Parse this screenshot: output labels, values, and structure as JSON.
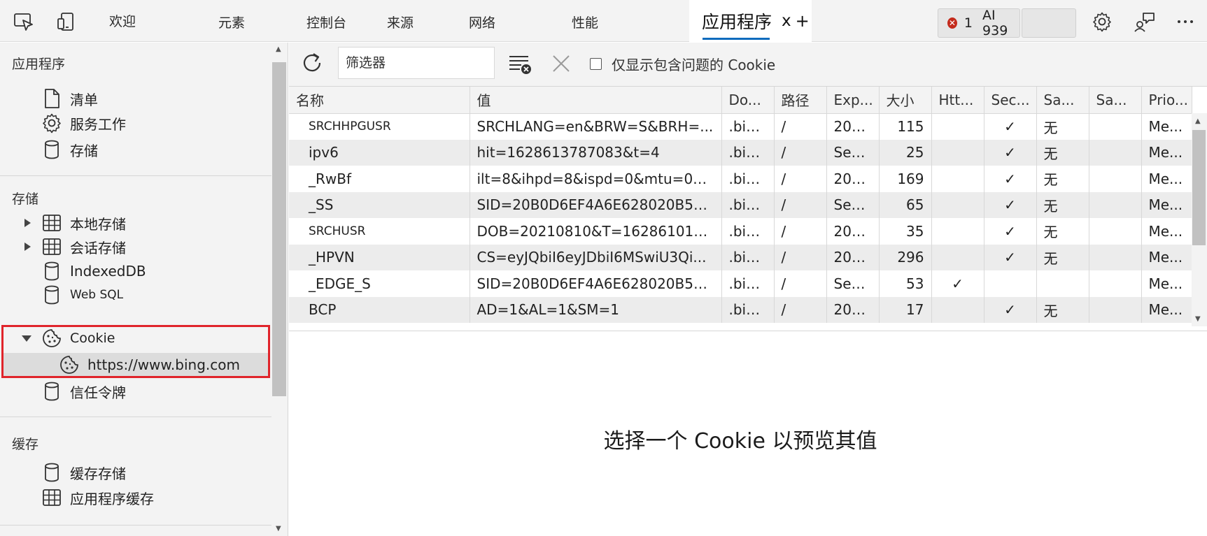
{
  "topbar": {
    "tabs": [
      "欢迎",
      "元素",
      "控制台",
      "来源",
      "网络",
      "性能"
    ],
    "active_tab": "应用程序",
    "close_label": "x",
    "new_tab_label": "+",
    "error_count": "1",
    "ai_label": "AI 939"
  },
  "sidebar": {
    "app_heading": "应用程序",
    "app_items": [
      "清单",
      "服务工作",
      "存储"
    ],
    "storage_heading": "存储",
    "storage_items": [
      "本地存储",
      "会话存储",
      "IndexedDB",
      "Web SQL",
      "Cookie",
      "https://www.bing.com",
      "信任令牌"
    ],
    "cache_heading": "缓存",
    "cache_items": [
      "缓存存储",
      "应用程序缓存"
    ]
  },
  "toolbar": {
    "filter_placeholder": "筛选器",
    "only_issues_label": "仅显示包含问题的 Cookie"
  },
  "table": {
    "columns": [
      "名称",
      "值",
      "Do...",
      "路径",
      "Exp...",
      "大小",
      "Htt...",
      "Sec...",
      "Sa...",
      "Sa...",
      "Prio..."
    ],
    "rows": [
      [
        "SRCHHPGUSR",
        "SRCHLANG=en&BRW=S&BRH=...",
        ".bin...",
        "/",
        "202...",
        "115",
        "",
        "✓",
        "无",
        "",
        "Me..."
      ],
      [
        "ipv6",
        "hit=1628613787083&t=4",
        ".bin...",
        "/",
        "Ses...",
        "25",
        "",
        "✓",
        "无",
        "",
        "Me..."
      ],
      [
        "_RwBf",
        "ilt=8&ihpd=8&ispd=0&mtu=0&...",
        ".bin...",
        "/",
        "202...",
        "169",
        "",
        "✓",
        "无",
        "",
        "Me..."
      ],
      [
        "_SS",
        "SID=20B0D6EF4A6E628020B5C6...",
        ".bin...",
        "/",
        "Ses...",
        "65",
        "",
        "✓",
        "无",
        "",
        "Me..."
      ],
      [
        "SRCHUSR",
        "DOB=20210810&T=1628610183...",
        ".bin...",
        "/",
        "202...",
        "35",
        "",
        "✓",
        "无",
        "",
        "Me..."
      ],
      [
        "_HPVN",
        "CS=eyJQbiI6eyJDbiI6MSwiU3Qi...",
        ".bin...",
        "/",
        "202...",
        "296",
        "",
        "✓",
        "无",
        "",
        "Me..."
      ],
      [
        "_EDGE_S",
        "SID=20B0D6EF4A6E628020B5C6...",
        ".bin...",
        "/",
        "Ses...",
        "53",
        "✓",
        "",
        "",
        "",
        "Me..."
      ],
      [
        "BCP",
        "AD=1&AL=1&SM=1",
        ".bin...",
        "/",
        "202...",
        "17",
        "",
        "✓",
        "无",
        "",
        "Me..."
      ]
    ]
  },
  "preview": {
    "message": "选择一个 Cookie 以预览其值"
  }
}
